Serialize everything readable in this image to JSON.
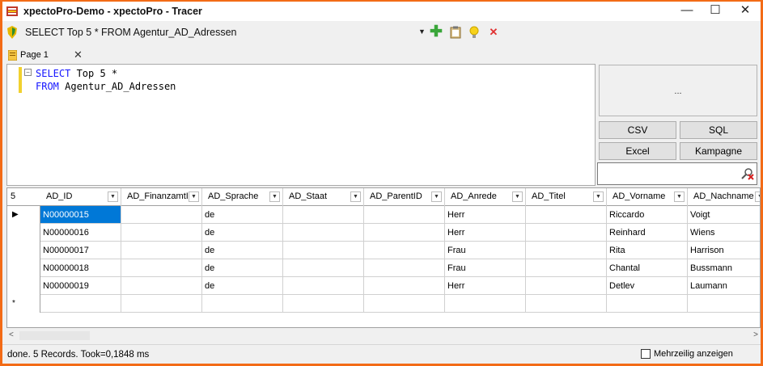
{
  "window": {
    "title": "xpectoPro-Demo - xpectoPro - Tracer",
    "minimize": "—",
    "maximize": "☐",
    "close": "✕"
  },
  "query_bar": {
    "title": "SELECT Top 5 * FROM Agentur_AD_Adressen",
    "dropdown_glyph": "▼",
    "actions": [
      {
        "name": "add-icon",
        "glyph": "✚"
      },
      {
        "name": "clipboard-icon",
        "glyph": ""
      },
      {
        "name": "lightbulb-icon",
        "glyph": "💡"
      },
      {
        "name": "delete-icon",
        "glyph": "✕"
      }
    ]
  },
  "tabs": [
    {
      "label": "Page 1",
      "close": "✕"
    }
  ],
  "editor": {
    "fold_glyph": "−",
    "lines": [
      [
        {
          "text": "SELECT",
          "kw": true
        },
        {
          "text": " Top 5 *",
          "kw": false
        }
      ],
      [
        {
          "text": "FROM",
          "kw": true
        },
        {
          "text": " Agentur_AD_Adressen",
          "kw": false
        }
      ]
    ]
  },
  "right_panel": {
    "info": "...",
    "buttons": [
      "CSV",
      "SQL",
      "Excel",
      "Kampagne"
    ],
    "filter_value": ""
  },
  "grid": {
    "record_count": "5",
    "columns": [
      "AD_ID",
      "AD_FinanzamtI",
      "AD_Sprache",
      "AD_Staat",
      "AD_ParentID",
      "AD_Anrede",
      "AD_Titel",
      "AD_Vorname",
      "AD_Nachname"
    ],
    "rows": [
      {
        "marker": "▶",
        "cells": [
          "N00000015",
          "",
          "de",
          "",
          "",
          "Herr",
          "",
          "Riccardo",
          "Voigt"
        ]
      },
      {
        "marker": "",
        "cells": [
          "N00000016",
          "",
          "de",
          "",
          "",
          "Herr",
          "",
          "Reinhard",
          "Wiens"
        ]
      },
      {
        "marker": "",
        "cells": [
          "N00000017",
          "",
          "de",
          "",
          "",
          "Frau",
          "",
          "Rita",
          "Harrison"
        ]
      },
      {
        "marker": "",
        "cells": [
          "N00000018",
          "",
          "de",
          "",
          "",
          "Frau",
          "",
          "Chantal",
          "Bussmann"
        ]
      },
      {
        "marker": "",
        "cells": [
          "N00000019",
          "",
          "de",
          "",
          "",
          "Herr",
          "",
          "Detlev",
          "Laumann"
        ]
      },
      {
        "marker": "*",
        "cells": [
          "",
          "",
          "",
          "",
          "",
          "",
          "",
          "",
          ""
        ]
      }
    ],
    "selected_cell": [
      0,
      0
    ]
  },
  "scrollbar": {
    "left": "<",
    "right": ">"
  },
  "status": {
    "text": "done. 5 Records. Took=0,1848 ms",
    "checkbox_label": "Mehrzeilig anzeigen",
    "checkbox_checked": false
  }
}
